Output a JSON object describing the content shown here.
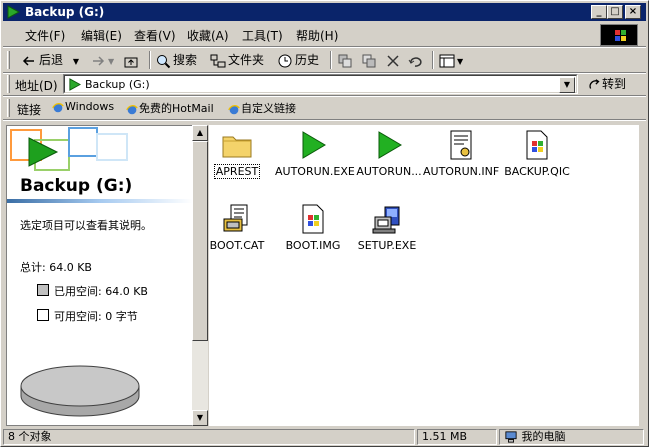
{
  "window": {
    "title": "Backup (G:)"
  },
  "menu": [
    "文件(F)",
    "编辑(E)",
    "查看(V)",
    "收藏(A)",
    "工具(T)",
    "帮助(H)"
  ],
  "toolbar": {
    "back": "后退",
    "search": "搜索",
    "folders": "文件夹",
    "history": "历史"
  },
  "address": {
    "label": "地址(D)",
    "value": "Backup (G:)",
    "go": "转到"
  },
  "links": {
    "label": "链接",
    "items": [
      "Windows",
      "免费的HotMail",
      "自定义链接"
    ]
  },
  "info_pane": {
    "title": "Backup (G:)",
    "hint": "选定项目可以查看其说明。",
    "total": "总计: 64.0 KB",
    "used": "已用空间: 64.0 KB",
    "free": "可用空间: 0 字节",
    "used_fraction": 1.0
  },
  "files": [
    {
      "name": "APREST",
      "icon": "folder-icon"
    },
    {
      "name": "AUTORUN.EXE",
      "icon": "green-arrow-icon"
    },
    {
      "name": "AUTORUN...",
      "icon": "green-arrow-icon"
    },
    {
      "name": "AUTORUN.INF",
      "icon": "settings-file-icon"
    },
    {
      "name": "BACKUP.QIC",
      "icon": "windows-file-icon"
    },
    {
      "name": "BOOT.CAT",
      "icon": "catalog-file-icon"
    },
    {
      "name": "BOOT.IMG",
      "icon": "windows-file-icon"
    },
    {
      "name": "SETUP.EXE",
      "icon": "setup-icon"
    }
  ],
  "status": {
    "count": "8 个对象",
    "size": "1.51 MB",
    "zone": "我的电脑"
  }
}
